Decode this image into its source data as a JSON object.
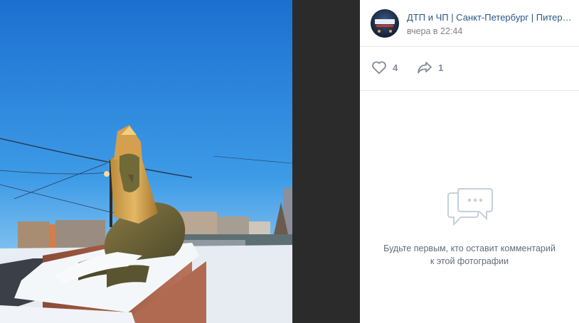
{
  "post": {
    "author_name": "ДТП и ЧП | Санкт-Петербург | Питер Онлайн | СПб",
    "time": "вчера в 22:44",
    "avatar_icon": "group-avatar-icon"
  },
  "actions": {
    "likes_count": "4",
    "shares_count": "1",
    "like_icon": "heart-icon",
    "share_icon": "share-arrow-icon"
  },
  "comments": {
    "empty_icon": "comments-bubble-icon",
    "empty_text": "Будьте первым, кто оставит комментарий к этой фотографии"
  },
  "colors": {
    "link": "#2a5885",
    "muted": "#828282",
    "action": "#828a99",
    "viewer_background": "#2b2b2b",
    "divider": "#e7e8ec"
  }
}
